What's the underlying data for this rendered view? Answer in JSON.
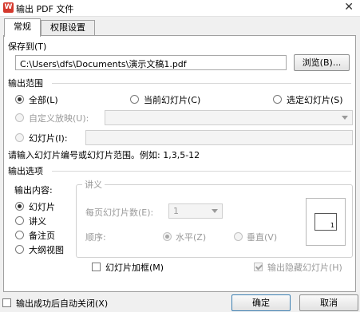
{
  "window": {
    "title": "输出 PDF 文件",
    "close_glyph": "✕"
  },
  "tabs": [
    {
      "label": "常规"
    },
    {
      "label": "权限设置"
    }
  ],
  "save_to": {
    "label": "保存到(T)",
    "path": "C:\\Users\\dfs\\Documents\\演示文稿1.pdf",
    "browse_label": "浏览(B)..."
  },
  "output_range": {
    "label": "输出范围",
    "all_label": "全部(L)",
    "current_label": "当前幻灯片(C)",
    "selected_label": "选定幻灯片(S)",
    "custom_label": "自定义放映(U):",
    "slides_label": "幻灯片(I):",
    "hint": "请输入幻灯片编号或幻灯片范围。例如: 1,3,5-12"
  },
  "output_options": {
    "label": "输出选项",
    "content_label": "输出内容:",
    "items": [
      "幻灯片",
      "讲义",
      "备注页",
      "大纲视图"
    ],
    "handout": {
      "legend": "讲义",
      "per_page_label": "每页幻灯片数(E):",
      "per_page_value": "1",
      "order_label": "顺序:",
      "horizontal_label": "水平(Z)",
      "vertical_label": "垂直(V)",
      "preview_number": "1"
    },
    "frame_label": "幻灯片加框(M)",
    "hidden_label": "输出隐藏幻灯片(H)"
  },
  "footer": {
    "auto_close_label": "输出成功后自动关闭(X)",
    "ok_label": "确定",
    "cancel_label": "取消"
  }
}
